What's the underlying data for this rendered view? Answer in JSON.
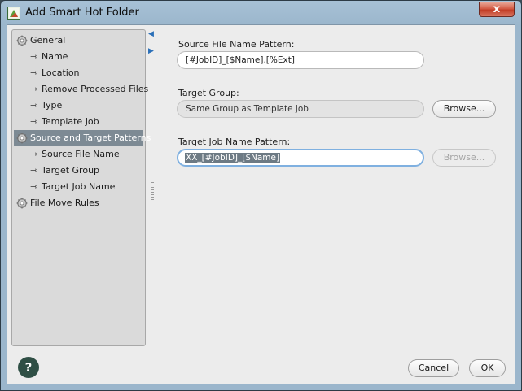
{
  "window": {
    "title": "Add Smart Hot Folder",
    "close_glyph": "x"
  },
  "tree": [
    {
      "label": "General",
      "level": 0,
      "icon": "gear-icon"
    },
    {
      "label": "Name",
      "level": 1,
      "icon": "arrow-right-icon"
    },
    {
      "label": "Location",
      "level": 1,
      "icon": "arrow-right-icon"
    },
    {
      "label": "Remove Processed Files",
      "level": 1,
      "icon": "arrow-right-icon"
    },
    {
      "label": "Type",
      "level": 1,
      "icon": "arrow-right-icon"
    },
    {
      "label": "Template Job",
      "level": 1,
      "icon": "arrow-right-icon"
    },
    {
      "label": "Source and Target Patterns",
      "level": 0,
      "icon": "gear-icon",
      "selected": true
    },
    {
      "label": "Source File Name",
      "level": 1,
      "icon": "arrow-right-icon"
    },
    {
      "label": "Target Group",
      "level": 1,
      "icon": "arrow-right-icon"
    },
    {
      "label": "Target Job Name",
      "level": 1,
      "icon": "arrow-right-icon"
    },
    {
      "label": "File Move Rules",
      "level": 0,
      "icon": "gear-icon"
    }
  ],
  "form": {
    "source_pattern_label": "Source File Name Pattern:",
    "source_pattern_value": "[#JobID]_[$Name].[%Ext]",
    "target_group_label": "Target Group:",
    "target_group_value": "Same Group as Template job",
    "target_job_label": "Target Job Name Pattern:",
    "target_job_value": "XX_[#JobID]_[$Name]"
  },
  "buttons": {
    "browse": "Browse...",
    "browse_disabled": "Browse...",
    "cancel": "Cancel",
    "ok": "OK",
    "help": "?"
  },
  "colors": {
    "accent": "#2a6fb8",
    "selection": "#7d8a94",
    "help_bg": "#2f4f45",
    "close_red": "#c23d26"
  }
}
